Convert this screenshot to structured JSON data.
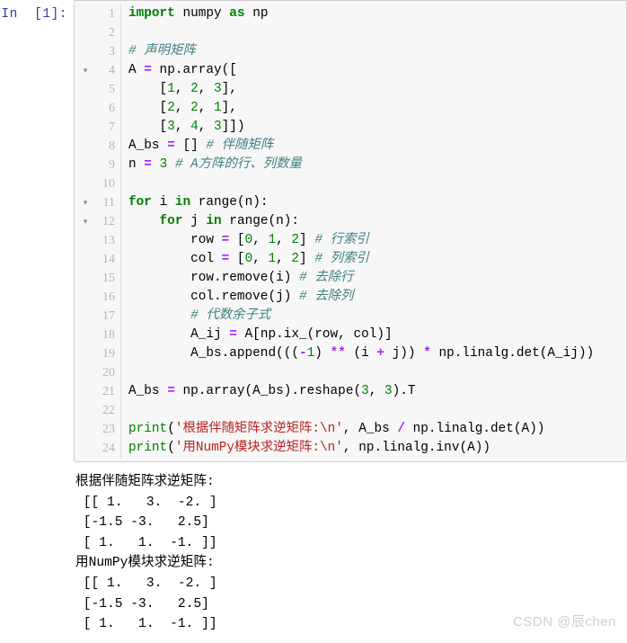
{
  "cell": {
    "prompt": "In  [1]:",
    "language": "python",
    "first_line_number": 1,
    "total_lines": 24,
    "fold_lines": [
      4,
      11,
      12
    ],
    "fold_marker": "▾",
    "lines": [
      {
        "n": 1,
        "tokens": [
          {
            "t": "kw",
            "v": "import"
          },
          {
            "t": "pl",
            "v": " numpy "
          },
          {
            "t": "kw",
            "v": "as"
          },
          {
            "t": "pl",
            "v": " np"
          }
        ]
      },
      {
        "n": 2,
        "tokens": []
      },
      {
        "n": 3,
        "tokens": [
          {
            "t": "cmt",
            "v": "# 声明矩阵"
          }
        ]
      },
      {
        "n": 4,
        "tokens": [
          {
            "t": "pl",
            "v": "A "
          },
          {
            "t": "op",
            "v": "="
          },
          {
            "t": "pl",
            "v": " np.array(["
          }
        ]
      },
      {
        "n": 5,
        "tokens": [
          {
            "t": "pl",
            "v": "    ["
          },
          {
            "t": "num",
            "v": "1"
          },
          {
            "t": "pl",
            "v": ", "
          },
          {
            "t": "num",
            "v": "2"
          },
          {
            "t": "pl",
            "v": ", "
          },
          {
            "t": "num",
            "v": "3"
          },
          {
            "t": "pl",
            "v": "],"
          }
        ]
      },
      {
        "n": 6,
        "tokens": [
          {
            "t": "pl",
            "v": "    ["
          },
          {
            "t": "num",
            "v": "2"
          },
          {
            "t": "pl",
            "v": ", "
          },
          {
            "t": "num",
            "v": "2"
          },
          {
            "t": "pl",
            "v": ", "
          },
          {
            "t": "num",
            "v": "1"
          },
          {
            "t": "pl",
            "v": "],"
          }
        ]
      },
      {
        "n": 7,
        "tokens": [
          {
            "t": "pl",
            "v": "    ["
          },
          {
            "t": "num",
            "v": "3"
          },
          {
            "t": "pl",
            "v": ", "
          },
          {
            "t": "num",
            "v": "4"
          },
          {
            "t": "pl",
            "v": ", "
          },
          {
            "t": "num",
            "v": "3"
          },
          {
            "t": "pl",
            "v": "]])"
          }
        ]
      },
      {
        "n": 8,
        "tokens": [
          {
            "t": "pl",
            "v": "A_bs "
          },
          {
            "t": "op",
            "v": "="
          },
          {
            "t": "pl",
            "v": " [] "
          },
          {
            "t": "cmt",
            "v": "# 伴随矩阵"
          }
        ]
      },
      {
        "n": 9,
        "tokens": [
          {
            "t": "pl",
            "v": "n "
          },
          {
            "t": "op",
            "v": "="
          },
          {
            "t": "pl",
            "v": " "
          },
          {
            "t": "num",
            "v": "3"
          },
          {
            "t": "pl",
            "v": " "
          },
          {
            "t": "cmt",
            "v": "# A方阵的行、列数量"
          }
        ]
      },
      {
        "n": 10,
        "tokens": []
      },
      {
        "n": 11,
        "tokens": [
          {
            "t": "kw",
            "v": "for"
          },
          {
            "t": "pl",
            "v": " i "
          },
          {
            "t": "kw",
            "v": "in"
          },
          {
            "t": "pl",
            "v": " range(n):"
          }
        ]
      },
      {
        "n": 12,
        "tokens": [
          {
            "t": "pl",
            "v": "    "
          },
          {
            "t": "kw",
            "v": "for"
          },
          {
            "t": "pl",
            "v": " j "
          },
          {
            "t": "kw",
            "v": "in"
          },
          {
            "t": "pl",
            "v": " range(n):"
          }
        ]
      },
      {
        "n": 13,
        "tokens": [
          {
            "t": "pl",
            "v": "        row "
          },
          {
            "t": "op",
            "v": "="
          },
          {
            "t": "pl",
            "v": " ["
          },
          {
            "t": "num",
            "v": "0"
          },
          {
            "t": "pl",
            "v": ", "
          },
          {
            "t": "num",
            "v": "1"
          },
          {
            "t": "pl",
            "v": ", "
          },
          {
            "t": "num",
            "v": "2"
          },
          {
            "t": "pl",
            "v": "] "
          },
          {
            "t": "cmt",
            "v": "# 行索引"
          }
        ]
      },
      {
        "n": 14,
        "tokens": [
          {
            "t": "pl",
            "v": "        col "
          },
          {
            "t": "op",
            "v": "="
          },
          {
            "t": "pl",
            "v": " ["
          },
          {
            "t": "num",
            "v": "0"
          },
          {
            "t": "pl",
            "v": ", "
          },
          {
            "t": "num",
            "v": "1"
          },
          {
            "t": "pl",
            "v": ", "
          },
          {
            "t": "num",
            "v": "2"
          },
          {
            "t": "pl",
            "v": "] "
          },
          {
            "t": "cmt",
            "v": "# 列索引"
          }
        ]
      },
      {
        "n": 15,
        "tokens": [
          {
            "t": "pl",
            "v": "        row.remove(i) "
          },
          {
            "t": "cmt",
            "v": "# 去除行"
          }
        ]
      },
      {
        "n": 16,
        "tokens": [
          {
            "t": "pl",
            "v": "        col.remove(j) "
          },
          {
            "t": "cmt",
            "v": "# 去除列"
          }
        ]
      },
      {
        "n": 17,
        "tokens": [
          {
            "t": "pl",
            "v": "        "
          },
          {
            "t": "cmt",
            "v": "# 代数余子式"
          }
        ]
      },
      {
        "n": 18,
        "tokens": [
          {
            "t": "pl",
            "v": "        A_ij "
          },
          {
            "t": "op",
            "v": "="
          },
          {
            "t": "pl",
            "v": " A[np.ix_(row, col)]"
          }
        ]
      },
      {
        "n": 19,
        "tokens": [
          {
            "t": "pl",
            "v": "        A_bs.append((("
          },
          {
            "t": "op",
            "v": "-"
          },
          {
            "t": "num",
            "v": "1"
          },
          {
            "t": "pl",
            "v": ") "
          },
          {
            "t": "op",
            "v": "**"
          },
          {
            "t": "pl",
            "v": " (i "
          },
          {
            "t": "op",
            "v": "+"
          },
          {
            "t": "pl",
            "v": " j)) "
          },
          {
            "t": "op",
            "v": "*"
          },
          {
            "t": "pl",
            "v": " np.linalg.det(A_ij))"
          }
        ]
      },
      {
        "n": 20,
        "tokens": []
      },
      {
        "n": 21,
        "tokens": [
          {
            "t": "pl",
            "v": "A_bs "
          },
          {
            "t": "op",
            "v": "="
          },
          {
            "t": "pl",
            "v": " np.array(A_bs).reshape("
          },
          {
            "t": "num",
            "v": "3"
          },
          {
            "t": "pl",
            "v": ", "
          },
          {
            "t": "num",
            "v": "3"
          },
          {
            "t": "pl",
            "v": ").T"
          }
        ]
      },
      {
        "n": 22,
        "tokens": []
      },
      {
        "n": 23,
        "tokens": [
          {
            "t": "bi",
            "v": "print"
          },
          {
            "t": "pl",
            "v": "("
          },
          {
            "t": "str",
            "v": "'根据伴随矩阵求逆矩阵:\\n'"
          },
          {
            "t": "pl",
            "v": ", A_bs "
          },
          {
            "t": "op",
            "v": "/"
          },
          {
            "t": "pl",
            "v": " np.linalg.det(A))"
          }
        ]
      },
      {
        "n": 24,
        "tokens": [
          {
            "t": "bi",
            "v": "print"
          },
          {
            "t": "pl",
            "v": "("
          },
          {
            "t": "str",
            "v": "'用NumPy模块求逆矩阵:\\n'"
          },
          {
            "t": "pl",
            "v": ", np.linalg.inv(A))"
          }
        ]
      }
    ],
    "source_text": "import numpy as np\n\n# 声明矩阵\nA = np.array([\n    [1, 2, 3],\n    [2, 2, 1],\n    [3, 4, 3]])\nA_bs = [] # 伴随矩阵\nn = 3 # A方阵的行、列数量\n\nfor i in range(n):\n    for j in range(n):\n        row = [0, 1, 2] # 行索引\n        col = [0, 1, 2] # 列索引\n        row.remove(i) # 去除行\n        col.remove(j) # 去除列\n        # 代数余子式\n        A_ij = A[np.ix_(row, col)]\n        A_bs.append((((-1) ** (i + j)) * np.linalg.det(A_ij))\n\nA_bs = np.array(A_bs).reshape(3, 3).T\n\nprint('根据伴随矩阵求逆矩阵:\\n', A_bs / np.linalg.det(A))\nprint('用NumPy模块求逆矩阵:\\n', np.linalg.inv(A))"
  },
  "output": {
    "stream": "stdout",
    "lines": [
      "根据伴随矩阵求逆矩阵:",
      " [[ 1.   3.  -2. ]",
      " [-1.5 -3.   2.5]",
      " [ 1.   1.  -1. ]]",
      "用NumPy模块求逆矩阵:",
      " [[ 1.   3.  -2. ]",
      " [-1.5 -3.   2.5]",
      " [ 1.   1.  -1. ]]"
    ],
    "text": "根据伴随矩阵求逆矩阵:\n [[ 1.   3.  -2. ]\n [-1.5 -3.   2.5]\n [ 1.   1.  -1. ]]\n用NumPy模块求逆矩阵:\n [[ 1.   3.  -2. ]\n [-1.5 -3.   2.5]\n [ 1.   1.  -1. ]]"
  },
  "watermark": {
    "text": "CSDN @辰chen"
  },
  "colors": {
    "prompt": "#303F9F",
    "cell_background": "#f7f7f7",
    "cell_border": "#cfcfcf",
    "line_number": "#b4b4b4",
    "keyword": "#008000",
    "builtin": "#008000",
    "number": "#008000",
    "comment": "#408080",
    "string": "#BA2121",
    "operator": "#AA22FF",
    "plain_text": "#000000",
    "watermark": "#cfcfcf"
  }
}
